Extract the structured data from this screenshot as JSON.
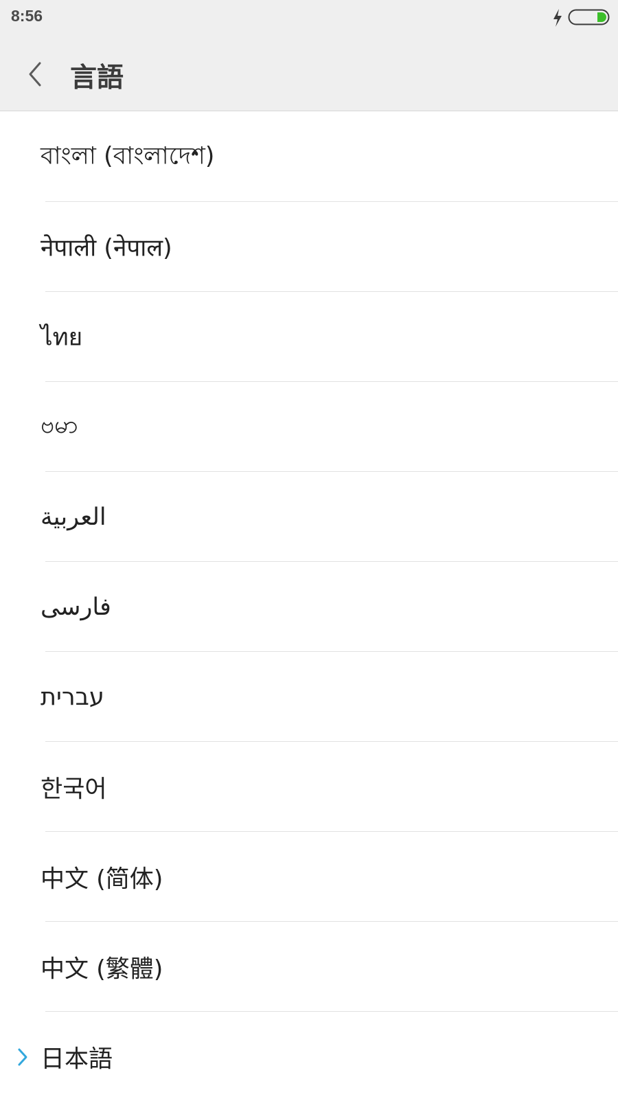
{
  "status_bar": {
    "time": "8:56",
    "charge_icon": "lightning-bolt-icon",
    "battery_icon": "battery-icon",
    "battery_color": "#3cbf2a"
  },
  "header": {
    "title": "言語",
    "back_icon": "chevron-left-icon"
  },
  "languages": [
    {
      "label": "বাংলা (বাংলাদেশ)"
    },
    {
      "label": "नेपाली (नेपाल)"
    },
    {
      "label": "ไทย"
    },
    {
      "label": "ဗမာ"
    },
    {
      "label": "العربية"
    },
    {
      "label": "فارسی"
    },
    {
      "label": "עברית"
    },
    {
      "label": "한국어"
    },
    {
      "label": "中文 (简体)"
    },
    {
      "label": "中文 (繁體)"
    },
    {
      "label": "日本語",
      "selected": true
    }
  ],
  "colors": {
    "accent": "#33a8dd",
    "header_bg": "#efefef",
    "divider": "#e2e2e2"
  }
}
